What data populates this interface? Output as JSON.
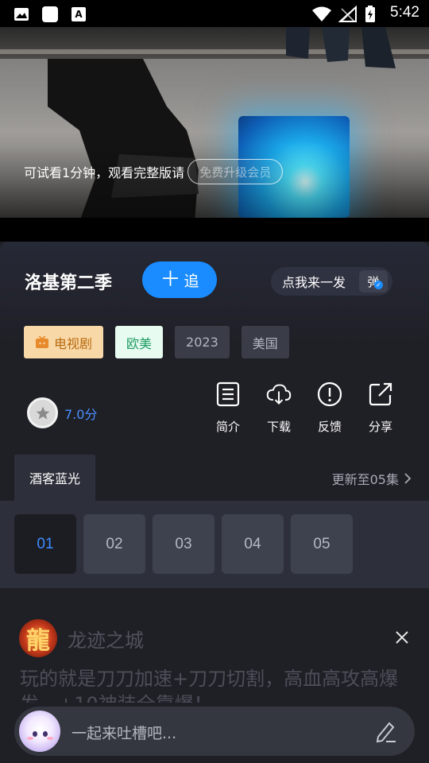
{
  "status_bar": {
    "time": "5:42",
    "icons": [
      "image-icon",
      "square-app-icon",
      "a-font-icon",
      "wifi-icon",
      "signal-icon",
      "battery-charging-icon"
    ]
  },
  "video": {
    "trial_text": "可试看1分钟，观看完整版请",
    "trial_button": "免费升级会员"
  },
  "show": {
    "title": "洛基第二季",
    "follow_label": "追",
    "danmu_label": "点我来一发",
    "danmu_icon_text": "弹"
  },
  "tags": {
    "type": "电视剧",
    "region": "欧美",
    "year": "2023",
    "country": "美国"
  },
  "rating": {
    "value": "7.0分"
  },
  "actions": {
    "intro": "简介",
    "download": "下载",
    "feedback": "反馈",
    "share": "分享"
  },
  "source": {
    "tab": "酒客蓝光",
    "update": "更新至05集"
  },
  "episodes": [
    "01",
    "02",
    "03",
    "04",
    "05"
  ],
  "ad": {
    "logo_char": "龍",
    "name": "龙迹之城",
    "text": "玩的就是刀刀加速+刀刀切割，高血高攻高爆发，+10神装全靠爆！"
  },
  "comment": {
    "placeholder": "一起来吐槽吧..."
  },
  "colors": {
    "accent": "#1a8cff",
    "active_episode": "#3d8cff",
    "tv_tag_bg": "#f8d8a6",
    "region_tag_bg": "#e7fbf1"
  }
}
